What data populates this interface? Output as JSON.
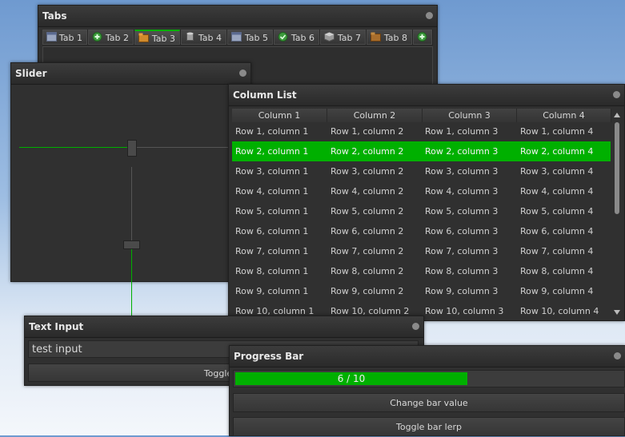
{
  "windows": {
    "tabs": {
      "title": "Tabs",
      "tabs": [
        {
          "label": "Tab 1",
          "icon": "window-icon"
        },
        {
          "label": "Tab 2",
          "icon": "add-circle-icon"
        },
        {
          "label": "Tab 3",
          "icon": "folder-icon",
          "active": true
        },
        {
          "label": "Tab 4",
          "icon": "cylinder-icon"
        },
        {
          "label": "Tab 5",
          "icon": "window-icon"
        },
        {
          "label": "Tab 6",
          "icon": "check-circle-icon"
        },
        {
          "label": "Tab 7",
          "icon": "cube-icon"
        },
        {
          "label": "Tab 8",
          "icon": "folder-icon"
        }
      ],
      "add_icon": "add-tab-icon"
    },
    "slider": {
      "title": "Slider",
      "horizontal_value": 0.49,
      "vertical_value": 0.5
    },
    "column_list": {
      "title": "Column List",
      "columns": [
        "Column 1",
        "Column 2",
        "Column 3",
        "Column 4"
      ],
      "rows": [
        [
          "Row 1, column 1",
          "Row 1, column 2",
          "Row 1, column 3",
          "Row 1, column 4"
        ],
        [
          "Row 2, column 1",
          "Row 2, column 2",
          "Row 2, column 3",
          "Row 2, column 4"
        ],
        [
          "Row 3, column 1",
          "Row 3, column 2",
          "Row 3, column 3",
          "Row 3, column 4"
        ],
        [
          "Row 4, column 1",
          "Row 4, column 2",
          "Row 4, column 3",
          "Row 4, column 4"
        ],
        [
          "Row 5, column 1",
          "Row 5, column 2",
          "Row 5, column 3",
          "Row 5, column 4"
        ],
        [
          "Row 6, column 1",
          "Row 6, column 2",
          "Row 6, column 3",
          "Row 6, column 4"
        ],
        [
          "Row 7, column 1",
          "Row 7, column 2",
          "Row 7, column 3",
          "Row 7, column 4"
        ],
        [
          "Row 8, column 1",
          "Row 8, column 2",
          "Row 8, column 3",
          "Row 8, column 4"
        ],
        [
          "Row 9, column 1",
          "Row 9, column 2",
          "Row 9, column 3",
          "Row 9, column 4"
        ],
        [
          "Row 10, column 1",
          "Row 10, column 2",
          "Row 10, column 3",
          "Row 10, column 4"
        ]
      ],
      "selected_row": 1
    },
    "text_input": {
      "title": "Text Input",
      "value": "test input",
      "button_label": "Toggle M"
    },
    "progress_bar": {
      "title": "Progress Bar",
      "value": 6,
      "max": 10,
      "text": "6 / 10",
      "change_label": "Change bar value",
      "toggle_label": "Toggle bar lerp"
    }
  },
  "colors": {
    "accent": "#00b000",
    "panel": "#303030"
  }
}
